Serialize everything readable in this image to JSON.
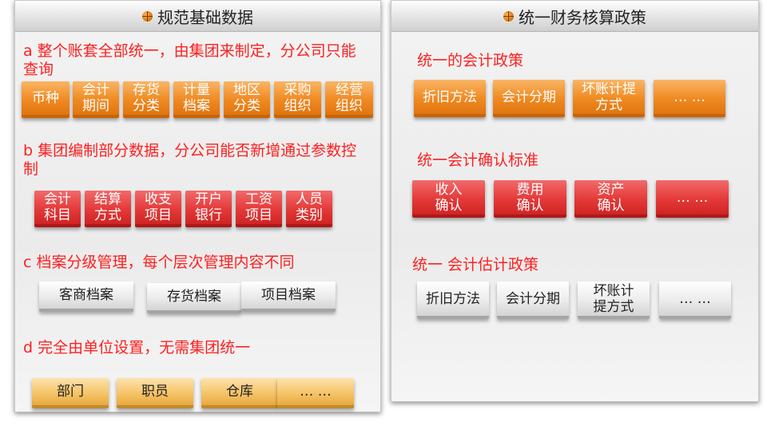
{
  "left_panel": {
    "title": "规范基础数据",
    "section_a": {
      "text": "a 整个账套全部统一，由集团来制定，分公司只能查询",
      "items": [
        "币种",
        "会计\n期间",
        "存货\n分类",
        "计量\n档案",
        "地区\n分类",
        "采购\n组织",
        "经营\n组织"
      ]
    },
    "section_b": {
      "text": "b 集团编制部分数据，分公司能否新增通过参数控制",
      "items": [
        "会计\n科目",
        "结算\n方式",
        "收支\n项目",
        "开户\n银行",
        "工资\n项目",
        "人员\n类别"
      ]
    },
    "section_c": {
      "text": "c 档案分级管理，每个层次管理内容不同",
      "items": [
        "客商档案",
        "存货档案",
        "项目档案"
      ]
    },
    "section_d": {
      "text": "d 完全由单位设置，无需集团统一",
      "items": [
        "部门",
        "职员",
        "仓库",
        "… …"
      ]
    }
  },
  "right_panel": {
    "title": "统一财务核算政策",
    "group1": {
      "heading": "统一的会计政策",
      "items": [
        "折旧方法",
        "会计分期",
        "坏账计提\n方式",
        "… …"
      ]
    },
    "group2": {
      "heading": "统一会计确认标准",
      "items": [
        "收入\n确认",
        "费用\n确认",
        "资产\n确认",
        "… …"
      ]
    },
    "group3": {
      "heading": "统一 会计估计政策",
      "items": [
        "折旧方法",
        "会计分期",
        "坏账计\n提方式",
        "… …"
      ]
    }
  },
  "colors": {
    "heading_red": "#ff1f1f",
    "orange_box": "#f08a22",
    "red_box": "#e43a3a",
    "gray_box": "#e6e6e6",
    "tan_box": "#f6c56a"
  }
}
